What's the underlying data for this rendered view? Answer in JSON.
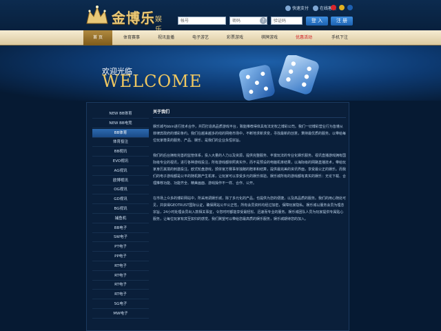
{
  "header": {
    "logo_main": "金博乐",
    "logo_sub": "娱乐城",
    "top_links": [
      "快速支付",
      "在线客服"
    ],
    "inputs": [
      {
        "placeholder": "帐号"
      },
      {
        "placeholder": "密码"
      },
      {
        "placeholder": "验证码"
      }
    ],
    "help_label": "?",
    "login_label": "登 入",
    "register_label": "注 册",
    "flag_colors": [
      "#d9262c",
      "#e0b020",
      "#1d5fb0"
    ]
  },
  "nav": {
    "items": [
      {
        "label": "首 页"
      },
      {
        "label": "体育赛事"
      },
      {
        "label": "视讯直播"
      },
      {
        "label": "电子游艺"
      },
      {
        "label": "彩票游戏"
      },
      {
        "label": "棋牌游戏"
      },
      {
        "label": "优惠活动"
      },
      {
        "label": "手机下注"
      }
    ]
  },
  "banner": {
    "welcome_cn": "欢迎光临",
    "welcome_en": "WELCOME"
  },
  "sidebar": {
    "items": [
      {
        "label": "NEW BB体育"
      },
      {
        "label": "NEW BB电竞"
      },
      {
        "label": "BB体育"
      },
      {
        "label": "体育投注"
      },
      {
        "label": "BB视讯"
      },
      {
        "label": "EVO视讯"
      },
      {
        "label": "AG视讯"
      },
      {
        "label": "欧博视讯"
      },
      {
        "label": "OG视讯"
      },
      {
        "label": "GD视讯"
      },
      {
        "label": "BG视讯"
      },
      {
        "label": "捕鱼机"
      },
      {
        "label": "BB电子"
      },
      {
        "label": "SW电子"
      },
      {
        "label": "PT电子"
      },
      {
        "label": "PP电子"
      },
      {
        "label": "RT电子"
      },
      {
        "label": "RT电子"
      },
      {
        "label": "RT电子"
      },
      {
        "label": "RT电子"
      },
      {
        "label": "SG电子"
      },
      {
        "label": "MW电子"
      }
    ],
    "active_index": 2
  },
  "content": {
    "title": "关于我们",
    "paragraphs": [
      "娱乐城与bbin进行技术合作，共同打造高品质游戏平台，致能推荐得体具有法定权之博彩公司。我们一切博彩营业行为皆遵从菲律宾政府的博彩条约。我们在越来越多的线的网络市场中，不断地求新求变，寻找最新的创意，秉持最优质的服务。以带给每位玩家尊贵的服务、产品、娱乐、是我们的企业永恒宗旨。",
      "我们的后台拥有完善的监管体系，投入大量的人力以及资源，提供完整服务、丰富玩法的专业化娱乐服务。视讯直播游戏拥有国际级专业的视讯，进行各种游戏投注，所有游戏都依照真实作，而不是预设的电脑机率结果，以海际级的网路直播技术，带给玩家身历其境的刺激投注。欧式轮盘游戏，颁依官方赛事单独赌的赔率和结算，提供最完美的资讯界面，享受最公正的娱乐。而我们的电子游戏都是公平的随机数产生机率，让玩家可以享受多元的娱乐体验。娱乐城所有的游戏都有真实的娱乐：无论下载、合理推荐功能、功能齐全、精美画面、游戏操作不一样、合作、公开。",
      "在市场上众多的博彩网站中，所采用调娱乐城，除了多元化的产品，也提供为您的便捷，以及高品质的服务。我们的用心随处可见，并获得GEOTRUST国际认证，确保网站公平公正性，所有会员资料均经过加密，保障玩家隐私。娱乐城以服务会员为理念宗旨，24小时处理会员出入款相关事宜，令您时时都能享受最轻松、迅速而专业的服务。娱乐城团队人员为玩家提供专属贴心服务，让每位玩家有宾至如归的感觉。我们冀望可以带给您最高质的娱乐服务，娱乐城期待您的加入。"
    ]
  }
}
